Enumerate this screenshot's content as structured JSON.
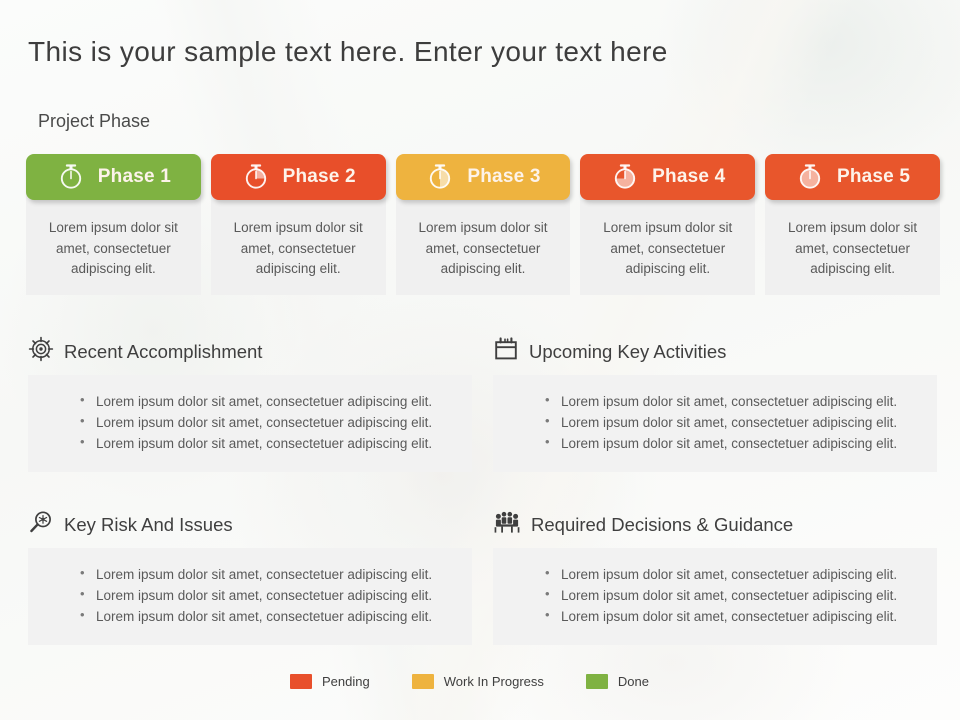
{
  "slide": {
    "title": "This is your sample text here. Enter your text here",
    "phase_section_label": "Project Phase"
  },
  "phases": [
    {
      "name": "Phase 1",
      "color": "#7fb242",
      "icon": "stopwatch-icon",
      "fill_pct": 0,
      "body": "Lorem ipsum dolor sit amet, consectetuer adipiscing elit."
    },
    {
      "name": "Phase 2",
      "color": "#e84f2a",
      "icon": "stopwatch-icon",
      "fill_pct": 25,
      "body": "Lorem ipsum dolor sit amet, consectetuer adipiscing elit."
    },
    {
      "name": "Phase 3",
      "color": "#eeb33f",
      "icon": "stopwatch-icon",
      "fill_pct": 50,
      "body": "Lorem ipsum dolor sit amet, consectetuer adipiscing elit."
    },
    {
      "name": "Phase 4",
      "color": "#e8562c",
      "icon": "stopwatch-icon",
      "fill_pct": 75,
      "body": "Lorem ipsum dolor sit amet, consectetuer adipiscing elit."
    },
    {
      "name": "Phase 5",
      "color": "#e8562c",
      "icon": "stopwatch-icon",
      "fill_pct": 100,
      "body": "Lorem ipsum dolor sit amet, consectetuer adipiscing elit."
    }
  ],
  "sections": [
    {
      "title": "Recent Accomplishment",
      "icon": "target-icon",
      "bullets": [
        "Lorem ipsum dolor sit amet, consectetuer adipiscing elit.",
        "Lorem ipsum dolor sit amet, consectetuer adipiscing elit.",
        "Lorem ipsum dolor sit amet, consectetuer adipiscing elit."
      ]
    },
    {
      "title": "Upcoming Key Activities",
      "icon": "calendar-icon",
      "bullets": [
        "Lorem ipsum dolor sit amet, consectetuer adipiscing elit.",
        "Lorem ipsum dolor sit amet, consectetuer adipiscing elit.",
        "Lorem ipsum dolor sit amet, consectetuer adipiscing elit."
      ]
    },
    {
      "title": "Key Risk And Issues",
      "icon": "magnifier-icon",
      "bullets": [
        "Lorem ipsum dolor sit amet, consectetuer adipiscing elit.",
        "Lorem ipsum dolor sit amet, consectetuer adipiscing elit.",
        "Lorem ipsum dolor sit amet, consectetuer adipiscing elit."
      ]
    },
    {
      "title": "Required Decisions & Guidance",
      "icon": "meeting-icon",
      "bullets": [
        "Lorem ipsum dolor sit amet, consectetuer adipiscing elit.",
        "Lorem ipsum dolor sit amet, consectetuer adipiscing elit.",
        "Lorem ipsum dolor sit amet, consectetuer adipiscing elit."
      ]
    }
  ],
  "legend": [
    {
      "label": "Pending",
      "color": "#e8502c"
    },
    {
      "label": "Work In Progress",
      "color": "#eeb33f"
    },
    {
      "label": "Done",
      "color": "#7fb242"
    }
  ]
}
